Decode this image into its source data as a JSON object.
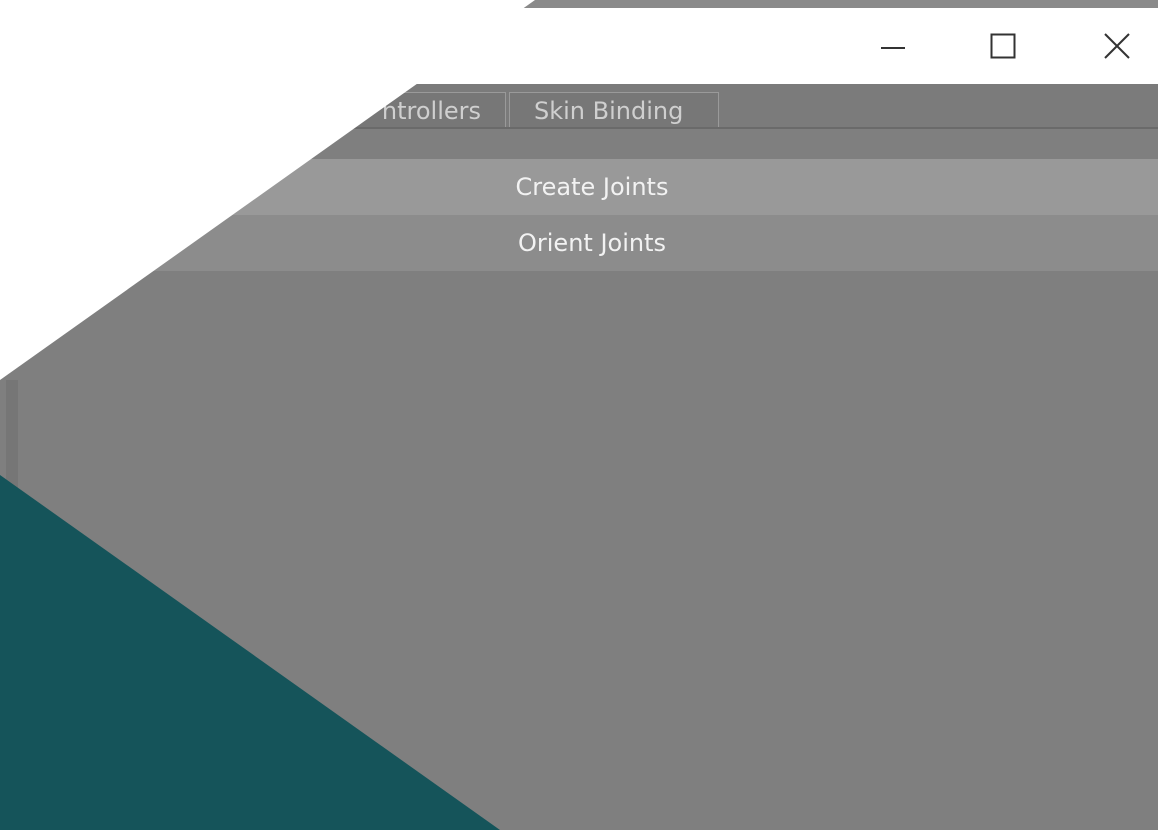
{
  "window": {
    "controls": {
      "minimize_icon": "minimize-icon",
      "maximize_icon": "maximize-icon",
      "close_icon": "close-icon"
    }
  },
  "tabs": [
    {
      "label": "ntrollers"
    },
    {
      "label": "Skin Binding"
    }
  ],
  "actions": {
    "create_joints": "Create Joints",
    "orient_joints": "Orient Joints"
  },
  "colors": {
    "panel_gray": "#7e7e7e",
    "title_bar": "#ffffff",
    "overlay_teal": "#15545a",
    "button_highlight": "#999999",
    "button_normal": "#8c8c8c"
  }
}
